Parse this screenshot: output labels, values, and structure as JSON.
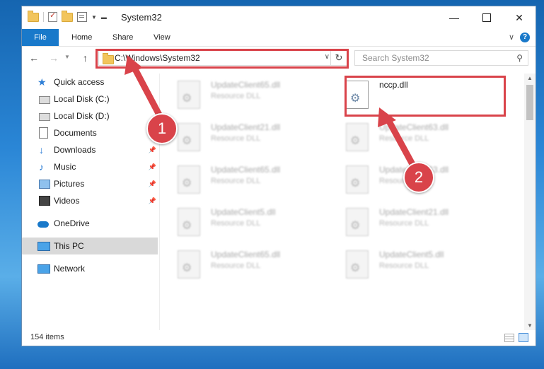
{
  "window": {
    "title": "System32",
    "controls": {
      "minimize": "—",
      "close": "✕"
    }
  },
  "ribbon": {
    "tabs": [
      "File",
      "Home",
      "Share",
      "View"
    ],
    "help": "?"
  },
  "navbar": {
    "address": "C:\\Windows\\System32",
    "search_placeholder": "Search System32"
  },
  "sidebar": {
    "items": [
      {
        "label": "Quick access",
        "icon": "star-icon"
      },
      {
        "label": "Local Disk (C:)",
        "icon": "disk-icon"
      },
      {
        "label": "Local Disk (D:)",
        "icon": "disk-icon"
      },
      {
        "label": "Documents",
        "icon": "documents-icon"
      },
      {
        "label": "Downloads",
        "icon": "downloads-icon",
        "pinned": true
      },
      {
        "label": "Music",
        "icon": "music-icon",
        "pinned": true
      },
      {
        "label": "Pictures",
        "icon": "pictures-icon",
        "pinned": true
      },
      {
        "label": "Videos",
        "icon": "videos-icon",
        "pinned": true
      },
      {
        "label": "OneDrive",
        "icon": "onedrive-icon"
      },
      {
        "label": "This PC",
        "icon": "pc-icon",
        "selected": true
      },
      {
        "label": "Network",
        "icon": "network-icon"
      }
    ]
  },
  "files": {
    "col1": [
      {
        "name": "UpdateClient65.dll",
        "type": "Resource DLL"
      },
      {
        "name": "UpdateClient21.dll",
        "type": "Resource DLL"
      },
      {
        "name": "UpdateClient65.dll",
        "type": "Resource DLL"
      },
      {
        "name": "UpdateClient5.dll",
        "type": "Resource DLL"
      },
      {
        "name": "UpdateClient65.dll",
        "type": "Resource DLL"
      }
    ],
    "col2": [
      {
        "name": "nccp.dll",
        "type": ""
      },
      {
        "name": "UpdateClient63.dll",
        "type": "Resource DLL"
      },
      {
        "name": "UpdateClient63.dll",
        "type": "Resource DLL"
      },
      {
        "name": "UpdateClient21.dll",
        "type": "Resource DLL"
      },
      {
        "name": "UpdateClient5.dll",
        "type": "Resource DLL"
      }
    ]
  },
  "status": {
    "items": "154 items"
  },
  "annotations": {
    "step1": "1",
    "step2": "2",
    "color": "#d9434a"
  }
}
